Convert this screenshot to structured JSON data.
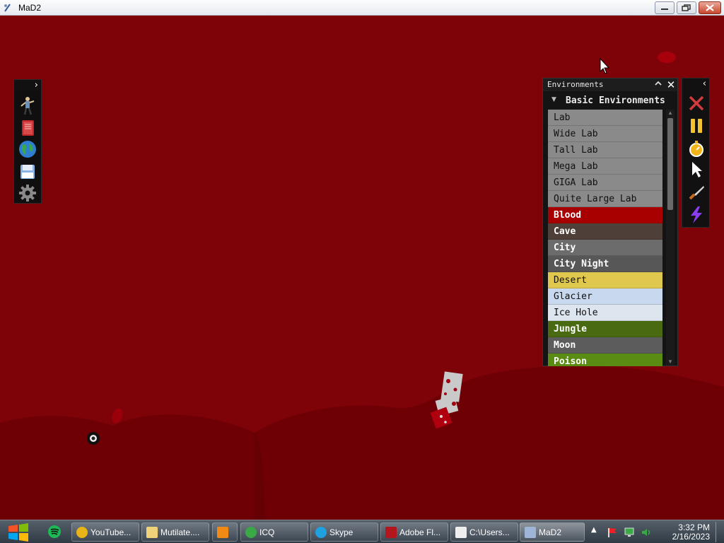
{
  "window": {
    "title": "MaD2",
    "icon": "mad2-app-icon",
    "controls": [
      "minimize-icon",
      "maximize-icon",
      "close-icon"
    ]
  },
  "left_toolbar": {
    "expand_glyph": "›",
    "tools": [
      {
        "name": "ragdoll-tool-icon"
      },
      {
        "name": "book-tool-icon"
      },
      {
        "name": "globe-environment-icon"
      },
      {
        "name": "save-disk-icon"
      },
      {
        "name": "settings-gear-icon"
      }
    ]
  },
  "environments_panel": {
    "title": "Environments",
    "collapse_glyph": "^",
    "close_glyph": "✕",
    "group": {
      "arrow": "▼",
      "label": "Basic Environments"
    },
    "items": [
      {
        "label": "Lab",
        "bg": "#8a8a8a",
        "fg": "#111111"
      },
      {
        "label": "Wide Lab",
        "bg": "#8a8a8a",
        "fg": "#111111"
      },
      {
        "label": "Tall Lab",
        "bg": "#8a8a8a",
        "fg": "#111111"
      },
      {
        "label": "Mega Lab",
        "bg": "#8a8a8a",
        "fg": "#111111"
      },
      {
        "label": "GIGA Lab",
        "bg": "#8a8a8a",
        "fg": "#111111"
      },
      {
        "label": "Quite Large Lab",
        "bg": "#8a8a8a",
        "fg": "#111111"
      },
      {
        "label": "Blood",
        "bg": "#a80000",
        "fg": "#ffffff"
      },
      {
        "label": "Cave",
        "bg": "#4e4038",
        "fg": "#ffffff"
      },
      {
        "label": "City",
        "bg": "#6c6c6c",
        "fg": "#ffffff"
      },
      {
        "label": "City Night",
        "bg": "#575757",
        "fg": "#ffffff"
      },
      {
        "label": "Desert",
        "bg": "#e0c74d",
        "fg": "#111111"
      },
      {
        "label": "Glacier",
        "bg": "#c8d8ee",
        "fg": "#111111"
      },
      {
        "label": "Ice Hole",
        "bg": "#dde6ef",
        "fg": "#111111"
      },
      {
        "label": "Jungle",
        "bg": "#4a6a12",
        "fg": "#ffffff"
      },
      {
        "label": "Moon",
        "bg": "#5c5c5c",
        "fg": "#ffffff"
      },
      {
        "label": "Poison",
        "bg": "#5a8c14",
        "fg": "#ffffff"
      }
    ]
  },
  "right_toolbar": {
    "collapse_glyph": "‹",
    "tools": [
      {
        "name": "clear-x-icon"
      },
      {
        "name": "pause-icon"
      },
      {
        "name": "stopwatch-icon"
      },
      {
        "name": "pointer-cursor-icon"
      },
      {
        "name": "knife-tool-icon"
      },
      {
        "name": "lightning-tool-icon"
      }
    ]
  },
  "colors": {
    "background": "#7d0308",
    "blood_ground": "#6e0005"
  },
  "taskbar": {
    "pinned": [
      "windows-start-icon",
      "spotify-icon"
    ],
    "buttons": [
      {
        "label": "YouTube...",
        "icon": "chrome-icon"
      },
      {
        "label": "Mutilate....",
        "icon": "folder-icon"
      },
      {
        "label": "",
        "icon": "vlc-icon"
      },
      {
        "label": "ICQ",
        "icon": "icq-icon"
      },
      {
        "label": "Skype",
        "icon": "skype-icon"
      },
      {
        "label": "Adobe Fl...",
        "icon": "flash-icon"
      },
      {
        "label": "C:\\Users...",
        "icon": "7zip-icon"
      },
      {
        "label": "MaD2",
        "icon": "mad2-app-icon"
      }
    ],
    "tray": [
      "tray-expand-icon",
      "flag-icon",
      "network-icon",
      "volume-icon"
    ],
    "clock": {
      "time": "3:32 PM",
      "date": "2/16/2023"
    }
  }
}
